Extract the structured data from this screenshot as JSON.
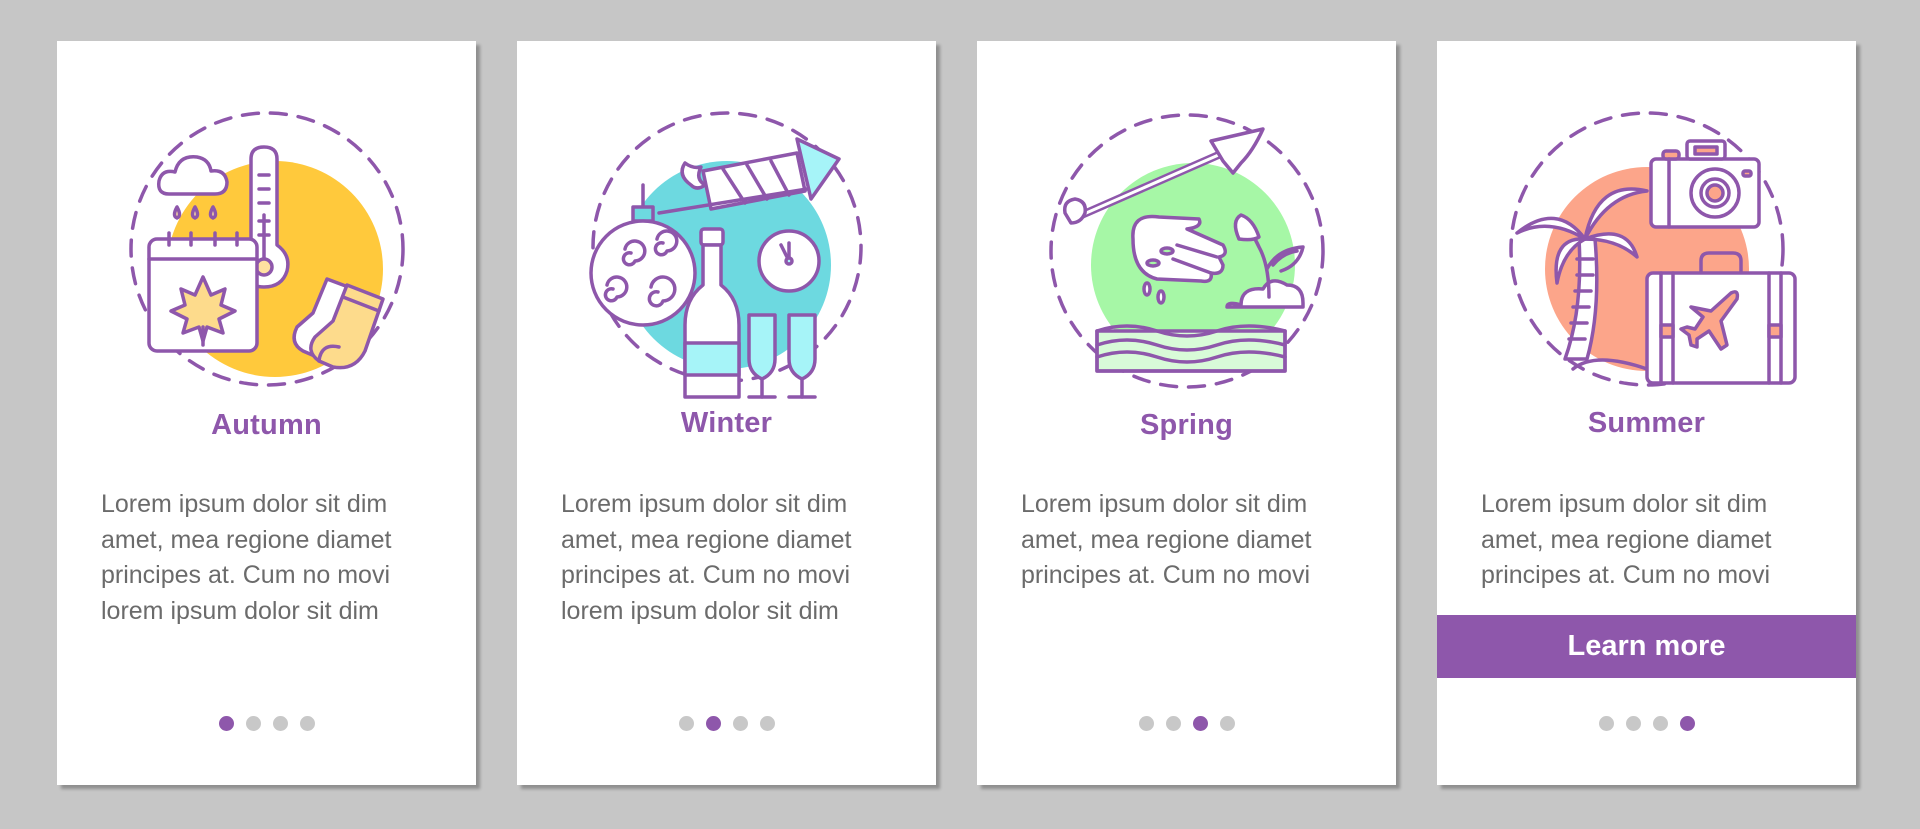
{
  "theme": {
    "accent": "#8e57ab",
    "text_gray": "#6b6b6b",
    "dot_inactive": "#c8c8c8",
    "background": "#c6c6c6"
  },
  "cards": [
    {
      "title": "Autumn",
      "body": "Lorem ipsum dolor sit dim amet, mea regione diamet principes at. Cum no movi lorem ipsum dolor sit dim",
      "illustration": "autumn-illustration",
      "blob_color": "#ffc93c",
      "page_index": 1,
      "page_count": 4
    },
    {
      "title": "Winter",
      "body": "Lorem ipsum dolor sit dim amet, mea regione diamet principes at. Cum no movi lorem ipsum dolor sit dim",
      "illustration": "winter-illustration",
      "blob_color": "#6dd9e0",
      "page_index": 2,
      "page_count": 4
    },
    {
      "title": "Spring",
      "body": "Lorem ipsum dolor sit dim amet, mea regione diamet principes at. Cum no movi",
      "illustration": "spring-illustration",
      "blob_color": "#a6f7a6",
      "page_index": 3,
      "page_count": 4
    },
    {
      "title": "Summer",
      "body": "Lorem ipsum dolor sit dim amet, mea regione diamet principes at. Cum no movi",
      "illustration": "summer-illustration",
      "blob_color": "#fca58a",
      "page_index": 4,
      "page_count": 4,
      "cta_label": "Learn more"
    }
  ]
}
